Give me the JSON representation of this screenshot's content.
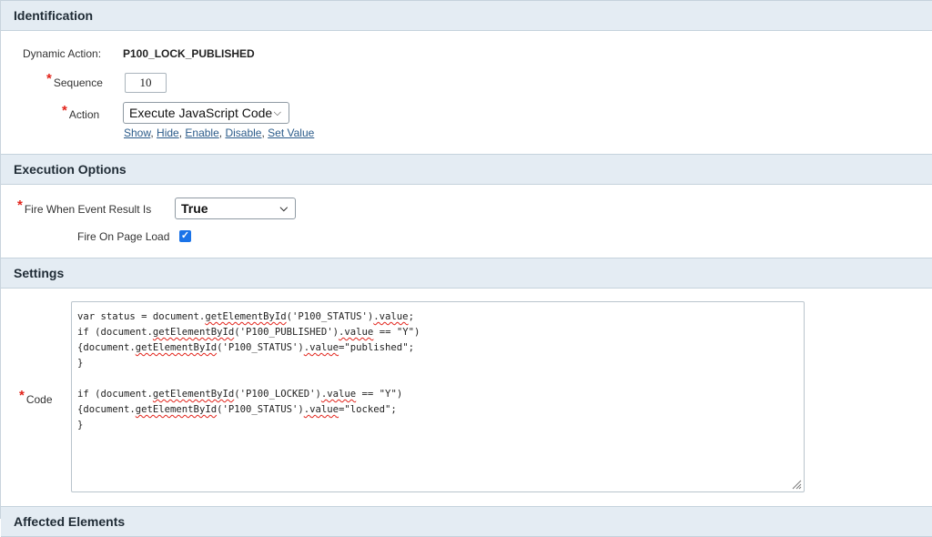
{
  "sections": {
    "identification": "Identification",
    "execution_options": "Execution Options",
    "settings": "Settings",
    "affected_elements": "Affected Elements"
  },
  "identification": {
    "dynamic_action_label": "Dynamic Action:",
    "dynamic_action_value": "P100_LOCK_PUBLISHED",
    "sequence_label": "Sequence",
    "sequence_value": "10",
    "action_label": "Action",
    "action_value": "Execute JavaScript Code",
    "quick_links": [
      "Show",
      "Hide",
      "Enable",
      "Disable",
      "Set Value"
    ]
  },
  "execution": {
    "fire_when_label": "Fire When Event Result Is",
    "fire_when_value": "True",
    "fire_on_load_label": "Fire On Page Load",
    "fire_on_load_checked": true
  },
  "settings": {
    "code_label": "Code",
    "code_lines": [
      "var status = document.getElementById('P100_STATUS').value;",
      "if (document.getElementById('P100_PUBLISHED').value == \"Y\")",
      "{document.getElementById('P100_STATUS').value=\"published\";",
      "}",
      "",
      "if (document.getElementById('P100_LOCKED').value == \"Y\")",
      "{document.getElementById('P100_STATUS').value=\"locked\";",
      "}"
    ]
  },
  "colors": {
    "section_bg": "#e4ecf3",
    "required_marker": "#e2231a",
    "link": "#2b5b8a",
    "checkbox": "#1a73e8"
  },
  "icons": [
    "chevron-down-icon",
    "check-icon",
    "resize-grip-icon"
  ]
}
